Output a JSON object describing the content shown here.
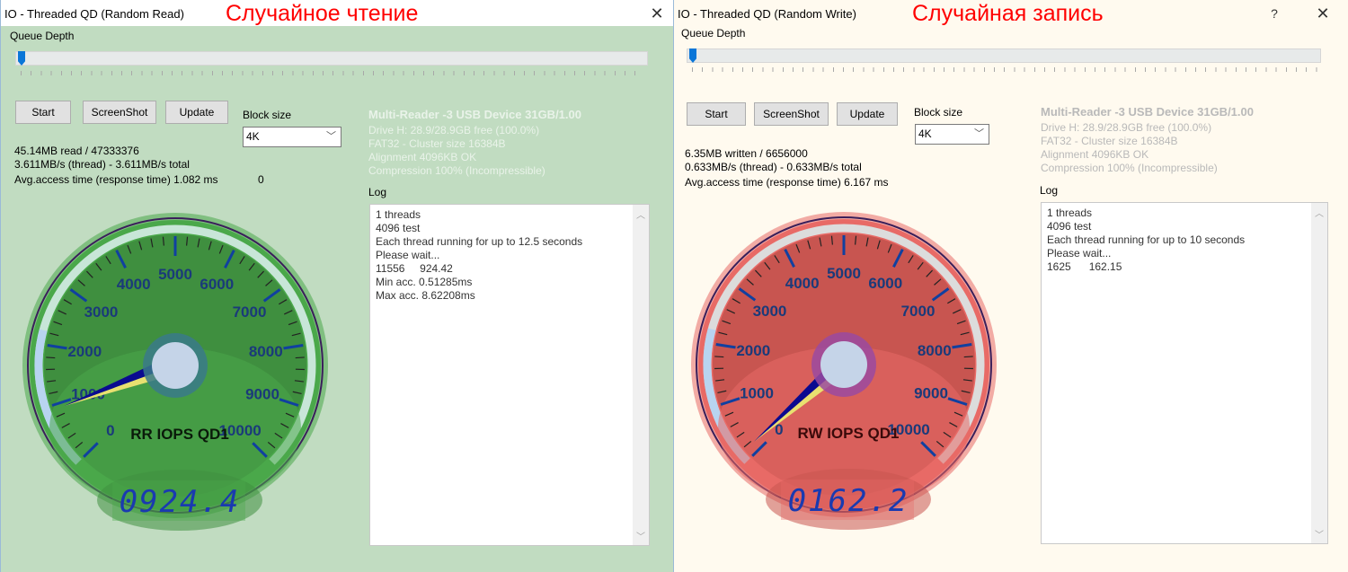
{
  "windows": [
    {
      "id": "read",
      "title": "IO - Threaded QD (Random Read)",
      "annotation": "Случайное чтение",
      "close_icon": "close-icon",
      "queue_depth_label": "Queue Depth",
      "queue_depth_value": 1,
      "buttons": {
        "start": "Start",
        "screenshot": "ScreenShot",
        "update": "Update"
      },
      "block_size_label": "Block size",
      "block_size_value": "4K",
      "stats": [
        "45.14MB read / 47333376",
        "3.611MB/s (thread) - 3.611MB/s total",
        "Avg.access time (response time) 1.082 ms"
      ],
      "extra_counter": "0",
      "device": {
        "name": "Multi-Reader  -3 USB Device 31GB/1.00",
        "lines": [
          "Drive H: 28.9/28.9GB free (100.0%)",
          "FAT32 - Cluster size 16384B",
          "Alignment 4096KB OK",
          "Compression 100% (Incompressible)"
        ]
      },
      "log_label": "Log",
      "log_lines": "1 threads\n4096 test\nEach thread running for up to 12.5 seconds\nPlease wait...\n11556     924.42\nMin acc. 0.51285ms\nMax acc. 8.62208ms",
      "gauge": {
        "label": "RR IOPS QD1",
        "value": 924.4,
        "display": "0924.4",
        "min": 0,
        "max": 10000,
        "tick_labels": [
          "0",
          "1000",
          "2000",
          "3000",
          "4000",
          "5000",
          "6000",
          "7000",
          "8000",
          "9000",
          "10000"
        ],
        "colors": {
          "face": "#3f8f3f",
          "rim": "#4aa84a",
          "hub_ring": "#3a7a8a"
        }
      }
    },
    {
      "id": "write",
      "title": "IO - Threaded QD (Random Write)",
      "annotation": "Случайная запись",
      "help_icon": "help-icon",
      "close_icon": "close-icon",
      "queue_depth_label": "Queue Depth",
      "queue_depth_value": 1,
      "buttons": {
        "start": "Start",
        "screenshot": "ScreenShot",
        "update": "Update"
      },
      "block_size_label": "Block size",
      "block_size_value": "4K",
      "stats": [
        "6.35MB written / 6656000",
        "0.633MB/s (thread) - 0.633MB/s total",
        "Avg.access time (response time) 6.167 ms"
      ],
      "device": {
        "name": "Multi-Reader  -3 USB Device 31GB/1.00",
        "lines": [
          "Drive H: 28.9/28.9GB free (100.0%)",
          "FAT32 - Cluster size 16384B",
          "Alignment 4096KB OK",
          "Compression 100% (Incompressible)"
        ]
      },
      "log_label": "Log",
      "log_lines": "1 threads\n4096 test\nEach thread running for up to 10 seconds\nPlease wait...\n1625      162.15",
      "gauge": {
        "label": "RW IOPS QD1",
        "value": 162.2,
        "display": "0162.2",
        "min": 0,
        "max": 10000,
        "tick_labels": [
          "0",
          "1000",
          "2000",
          "3000",
          "4000",
          "5000",
          "6000",
          "7000",
          "8000",
          "9000",
          "10000"
        ],
        "colors": {
          "face": "#c85550",
          "rim": "#e86a66",
          "hub_ring": "#9a4aa0"
        }
      }
    }
  ]
}
